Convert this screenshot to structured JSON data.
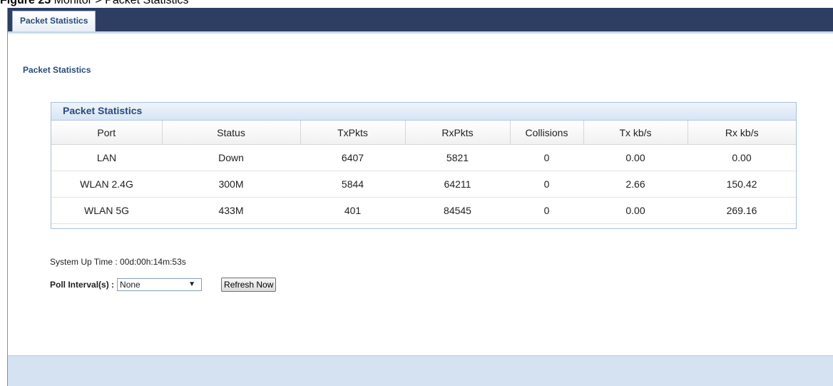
{
  "caption": {
    "figure": "Figure 25",
    "text": "Monitor > Packet Statistics"
  },
  "tab": {
    "label": "Packet Statistics"
  },
  "page": {
    "title": "Packet Statistics"
  },
  "panel": {
    "title": "Packet Statistics"
  },
  "table": {
    "headers": [
      "Port",
      "Status",
      "TxPkts",
      "RxPkts",
      "Collisions",
      "Tx kb/s",
      "Rx kb/s"
    ],
    "rows": [
      [
        "LAN",
        "Down",
        "6407",
        "5821",
        "0",
        "0.00",
        "0.00"
      ],
      [
        "WLAN 2.4G",
        "300M",
        "5844",
        "64211",
        "0",
        "2.66",
        "150.42"
      ],
      [
        "WLAN 5G",
        "433M",
        "401",
        "84545",
        "0",
        "0.00",
        "269.16"
      ]
    ]
  },
  "uptime": {
    "label": "System Up Time :",
    "value": "00d:00h:14m:53s"
  },
  "poll": {
    "label": "Poll Interval(s) :",
    "selected": "None",
    "refresh_label": "Refresh Now"
  }
}
